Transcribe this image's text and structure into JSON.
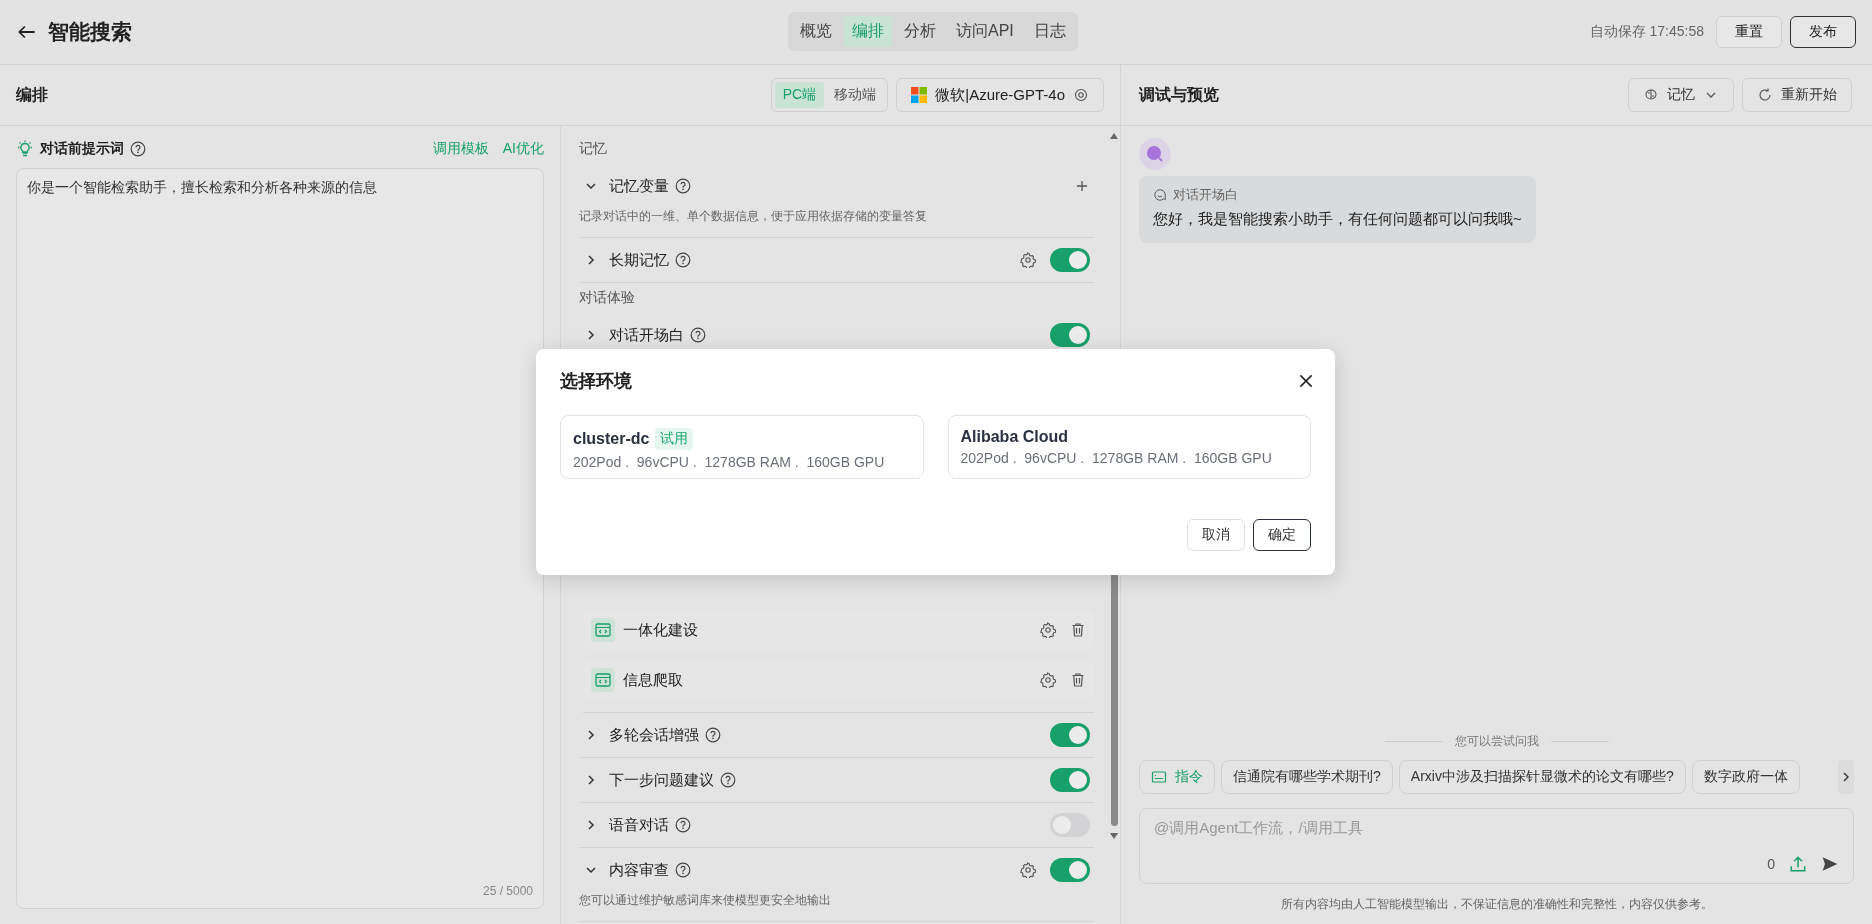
{
  "header": {
    "title": "智能搜索",
    "tabs": [
      {
        "label": "概览",
        "selected": false
      },
      {
        "label": "编排",
        "selected": true
      },
      {
        "label": "分析",
        "selected": false
      },
      {
        "label": "访问API",
        "selected": false
      },
      {
        "label": "日志",
        "selected": false
      }
    ],
    "autosave": "自动保存 17:45:58",
    "buttons": [
      {
        "label": "重置",
        "kind": "default"
      },
      {
        "label": "发布",
        "kind": "outline"
      }
    ]
  },
  "editor": {
    "title": "编排",
    "platforms": [
      {
        "label": "PC端",
        "selected": true
      },
      {
        "label": "移动端",
        "selected": false
      }
    ],
    "model": "微软|Azure-GPT-4o"
  },
  "prompt": {
    "title": "对话前提示词",
    "links": [
      "调用模板",
      "AI优化"
    ],
    "value": "你是一个智能检索助手，擅长检索和分析各种来源的信息",
    "counter": "25 / 5000"
  },
  "config": [
    {
      "kind": "section",
      "label": "记忆"
    },
    {
      "kind": "setting",
      "label": "记忆变量",
      "expanded": true,
      "add": true,
      "description": "记录对话中的一维、单个数据信息，便于应用依据存储的变量答复"
    },
    {
      "kind": "setting",
      "label": "长期记忆",
      "expanded": false,
      "settings": true,
      "on": true
    },
    {
      "kind": "section",
      "label": "对话体验"
    },
    {
      "kind": "setting",
      "label": "对话开场白",
      "expanded": false,
      "on": true
    },
    {
      "kind": "plugin",
      "label": "一体化建设"
    },
    {
      "kind": "plugin",
      "label": "信息爬取"
    },
    {
      "kind": "setting",
      "label": "多轮会话增强",
      "expanded": false,
      "on": true
    },
    {
      "kind": "setting",
      "label": "下一步问题建议",
      "expanded": false,
      "on": true
    },
    {
      "kind": "setting",
      "label": "语音对话",
      "expanded": false,
      "on": false
    },
    {
      "kind": "setting",
      "label": "内容审查",
      "expanded": true,
      "settings": true,
      "on": true,
      "description": "您可以通过维护敏感词库来使模型更安全地输出"
    }
  ],
  "preview": {
    "title": "调试与预览",
    "memory_button": "记忆",
    "restart_button": "重新开始",
    "greeting_label": "对话开场白",
    "greeting": "您好，我是智能搜索小助手，有任何问题都可以问我哦~",
    "suggest_title": "您可以尝试问我",
    "command_chip": "指令",
    "suggestions": [
      "信通院有哪些学术期刊?",
      "Arxiv中涉及扫描探针显微术的论文有哪些?",
      "数字政府一体"
    ],
    "input_placeholder": "@调用Agent工作流，/调用工具",
    "count": "0",
    "disclaimer": "所有内容均由人工智能模型输出，不保证信息的准确性和完整性，内容仅供参考。"
  },
  "dialog": {
    "title": "选择环境",
    "environments": [
      {
        "name": "cluster-dc",
        "tag": "试用",
        "specs": "202Pod .  96vCPU .  1278GB RAM .  160GB GPU"
      },
      {
        "name": "Alibaba Cloud",
        "specs": "202Pod .  96vCPU .  1278GB RAM .  160GB GPU"
      }
    ],
    "buttons": [
      {
        "label": "取消",
        "kind": "default"
      },
      {
        "label": "确定",
        "kind": "primary"
      }
    ]
  }
}
